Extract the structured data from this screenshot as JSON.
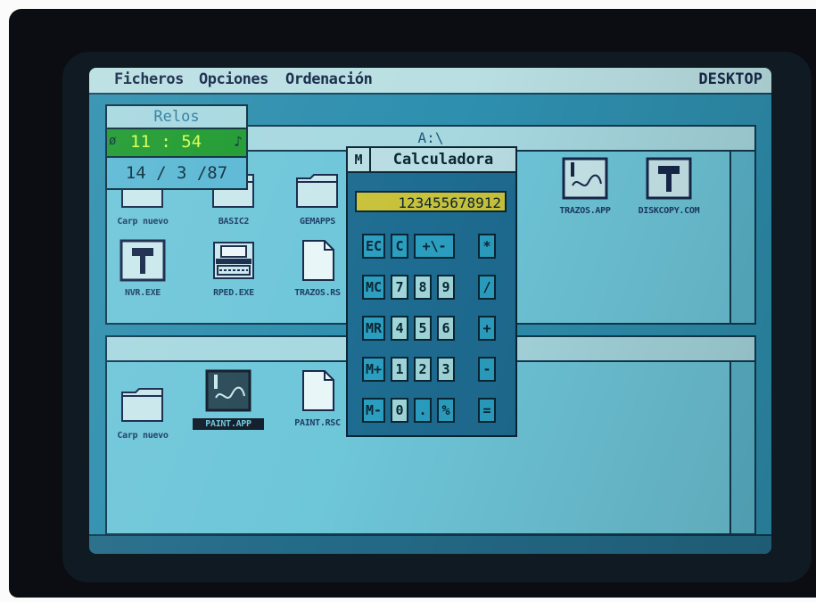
{
  "menubar": {
    "items": [
      "Ficheros",
      "Opciones",
      "Ordenación"
    ],
    "desktop_label": "DESKTOP"
  },
  "clock": {
    "title": "Relos",
    "time": "11 : 54",
    "date": "14 / 3 /87"
  },
  "window_top": {
    "title": "A:\\",
    "icons": [
      {
        "label": "Carp nuevo",
        "type": "folder-icon"
      },
      {
        "label": "BASIC2",
        "type": "folder-icon"
      },
      {
        "label": "GEMAPPS",
        "type": "folder-icon"
      },
      {
        "label": "TRAZOS.APP",
        "type": "paint-app-icon"
      },
      {
        "label": "DISKCOPY.COM",
        "type": "hammer-icon"
      },
      {
        "label": "NVR.EXE",
        "type": "hammer-icon"
      },
      {
        "label": "RPED.EXE",
        "type": "typewriter-icon"
      },
      {
        "label": "TRAZOS.RS",
        "type": "document-icon"
      }
    ]
  },
  "window_bottom": {
    "icons": [
      {
        "label": "Carp nuevo",
        "type": "folder-icon",
        "selected": false
      },
      {
        "label": "PAINT.APP",
        "type": "paint-app-icon",
        "selected": true
      },
      {
        "label": "PAINT.RSC",
        "type": "document-icon",
        "selected": false
      }
    ]
  },
  "calculator": {
    "title": "Calculadora",
    "close": "M",
    "display": "123455678912",
    "keys": [
      [
        "EC",
        "C",
        "+\\-",
        "*"
      ],
      [
        "MC",
        "7",
        "8",
        "9",
        "/"
      ],
      [
        "MR",
        "4",
        "5",
        "6",
        "+"
      ],
      [
        "M+",
        "1",
        "2",
        "3",
        "-"
      ],
      [
        "M-",
        "0",
        ".",
        "%",
        "="
      ]
    ]
  }
}
